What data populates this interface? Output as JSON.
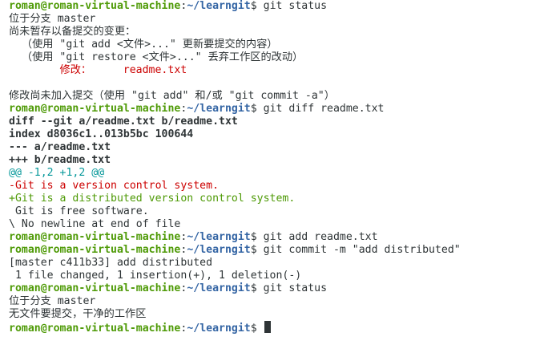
{
  "prompt": {
    "user_host": "roman@roman-virtual-machine",
    "separator": ":",
    "path": "~/learngit",
    "symbol": "$ "
  },
  "colors": {
    "prompt_user": "#4e9a06",
    "prompt_path": "#3465a4",
    "diff_hunk": "#06989a",
    "diff_removed": "#cc0000",
    "diff_added": "#4e9a06",
    "modified_file": "#cc0000",
    "cursor": "#2e3436",
    "text": "#2e3436",
    "background": "#ffffff"
  },
  "lines": [
    {
      "type": "prompt",
      "command": "git status"
    },
    {
      "type": "text",
      "text": "位于分支 master"
    },
    {
      "type": "text",
      "text": "尚未暂存以备提交的变更："
    },
    {
      "type": "text",
      "text": "  （使用 \"git add <文件>...\" 更新要提交的内容）"
    },
    {
      "type": "text",
      "text": "  （使用 \"git restore <文件>...\" 丢弃工作区的改动）"
    },
    {
      "type": "modified",
      "label": "\t修改：     ",
      "file": "readme.txt"
    },
    {
      "type": "blank",
      "text": ""
    },
    {
      "type": "text",
      "text": "修改尚未加入提交（使用 \"git add\" 和/或 \"git commit -a\"）"
    },
    {
      "type": "prompt",
      "command": "git diff readme.txt"
    },
    {
      "type": "bold",
      "text": "diff --git a/readme.txt b/readme.txt"
    },
    {
      "type": "bold",
      "text": "index d8036c1..013b5bc 100644"
    },
    {
      "type": "bold",
      "text": "--- a/readme.txt"
    },
    {
      "type": "bold",
      "text": "+++ b/readme.txt"
    },
    {
      "type": "hunk",
      "text": "@@ -1,2 +1,2 @@"
    },
    {
      "type": "del",
      "text": "-Git is a version control system."
    },
    {
      "type": "add",
      "text": "+Git is a distributed version control system."
    },
    {
      "type": "text",
      "text": " Git is free software."
    },
    {
      "type": "text",
      "text": "\\ No newline at end of file"
    },
    {
      "type": "prompt",
      "command": "git add readme.txt"
    },
    {
      "type": "prompt",
      "command": "git commit -m \"add distributed\""
    },
    {
      "type": "text",
      "text": "[master c411b33] add distributed"
    },
    {
      "type": "text",
      "text": " 1 file changed, 1 insertion(+), 1 deletion(-)"
    },
    {
      "type": "prompt",
      "command": "git status"
    },
    {
      "type": "text",
      "text": "位于分支 master"
    },
    {
      "type": "text",
      "text": "无文件要提交，干净的工作区"
    },
    {
      "type": "prompt",
      "command": "",
      "cursor": true
    }
  ]
}
